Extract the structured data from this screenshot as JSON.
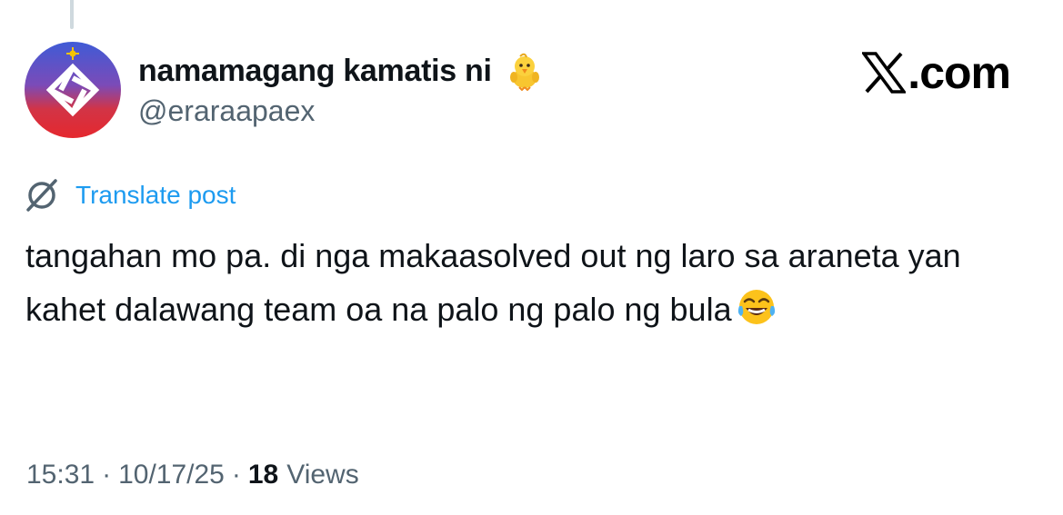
{
  "author": {
    "display_name": "namamagang kamatis ni",
    "name_emoji": "front-facing-baby-chick-emoji",
    "handle": "@eraraapaex",
    "avatar": "avatar-blue-red-gradient-star-logo"
  },
  "brand": {
    "logo_icon": "x-logo-icon",
    "text": ".com"
  },
  "translate": {
    "icon": "globe-translate-icon",
    "label": "Translate post"
  },
  "post": {
    "text": "tangahan mo pa. di nga makaasolved out ng laro sa araneta yan kahet dalawang team oa na palo ng palo ng bula",
    "trailing_emoji": "face-with-tears-of-joy-emoji"
  },
  "meta": {
    "time": "15:31",
    "separator": "·",
    "date": "10/17/25",
    "views_count": "18",
    "views_label": "Views"
  },
  "colors": {
    "link": "#1d9bf0",
    "secondary_text": "#536471",
    "primary_text": "#0f1419",
    "thread_line": "#cfd9de",
    "avatar_gradient_top": "#3f5bd6",
    "avatar_gradient_bottom": "#e5282e"
  }
}
